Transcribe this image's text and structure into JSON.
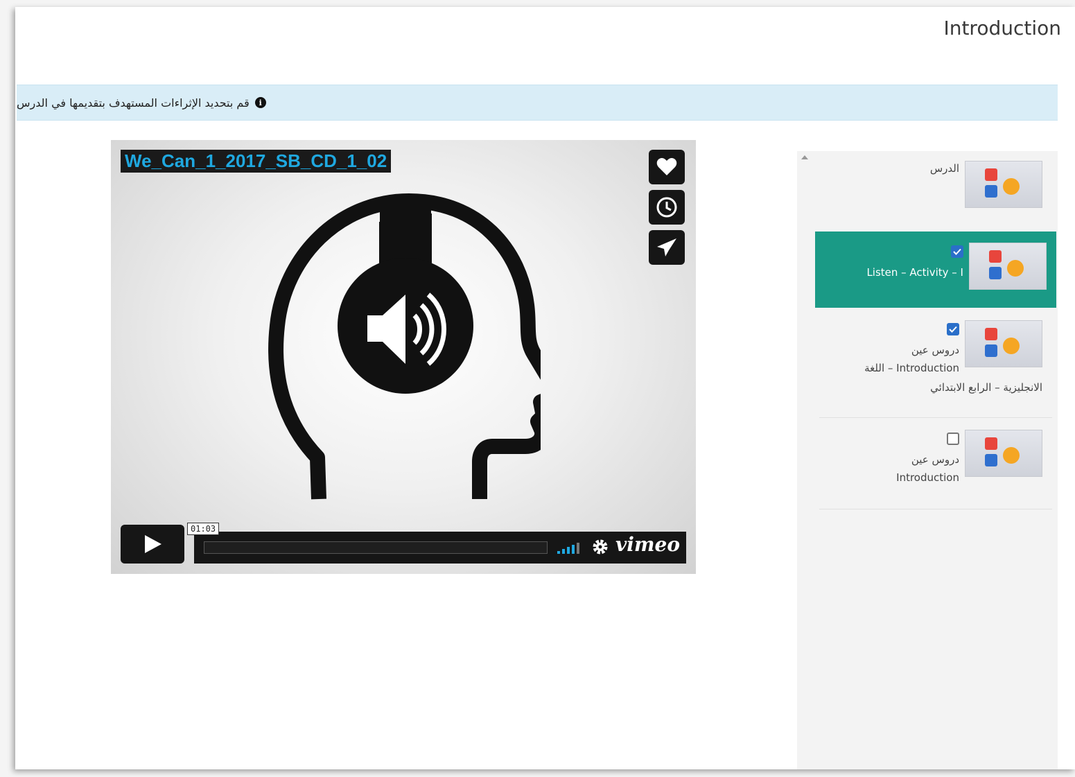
{
  "header": {
    "title": "Introduction"
  },
  "info": {
    "message": "قم بتحديد الإثراءات المستهدف بتقديمها في الدرس",
    "icon": "info-icon"
  },
  "video": {
    "title": "We_Can_1_2017_SB_CD_1_02",
    "time": "01:03",
    "brand": "vimeo",
    "side_buttons": [
      "heart-icon",
      "clock-icon",
      "send-icon"
    ]
  },
  "sidebar": {
    "items": [
      {
        "label": "الدرس",
        "checked": null,
        "active": false
      },
      {
        "label": "Listen – Activity – I",
        "checked": true,
        "active": true
      },
      {
        "line1": "دروس عين",
        "line2": "Introduction – اللغة",
        "line3": "الانجليزية – الرابع الابتدائي",
        "checked": true,
        "active": false
      },
      {
        "line1": "دروس عين",
        "line2": "Introduction",
        "checked": false,
        "active": false
      }
    ]
  },
  "colors": {
    "active": "#1a9a86",
    "info_bg": "#d9edf7",
    "title_blue": "#1fa8e0",
    "checkbox": "#2a6fc9"
  }
}
